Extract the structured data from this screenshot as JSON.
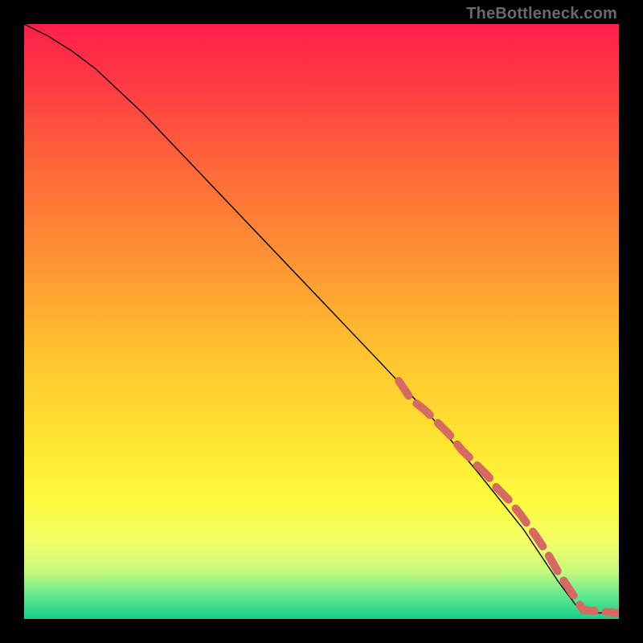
{
  "watermark": "TheBottleneck.com",
  "chart_data": {
    "type": "line",
    "title": "",
    "xlabel": "",
    "ylabel": "",
    "xlim": [
      0,
      100
    ],
    "ylim": [
      0,
      100
    ],
    "grid": false,
    "series": [
      {
        "name": "curve",
        "x": [
          0,
          4,
          8,
          12,
          20,
          30,
          40,
          50,
          60,
          68,
          76,
          84,
          90,
          93,
          96,
          100
        ],
        "y": [
          100,
          98,
          95.5,
          92.5,
          85,
          74.5,
          64,
          53.5,
          43,
          34.5,
          25,
          15,
          6,
          2,
          1,
          1
        ],
        "style": "solid",
        "color": "#000000",
        "width": 1.4
      },
      {
        "name": "dashed-overlay",
        "x": [
          63,
          65,
          67.5,
          68.5,
          70,
          71.5,
          73.5,
          75.5,
          78,
          79.5,
          81.5,
          83.5,
          86,
          88,
          90,
          94,
          97.5,
          100
        ],
        "y": [
          40,
          37,
          35,
          34,
          32.5,
          31,
          28.5,
          26.5,
          24,
          22,
          20,
          17.5,
          14,
          11,
          7.5,
          1.5,
          1.2,
          1
        ],
        "style": "dashed",
        "color": "#d66a63",
        "width": 10
      }
    ],
    "background_gradient": {
      "stops": [
        {
          "t": 0.0,
          "color": "#ff1f4b"
        },
        {
          "t": 0.1,
          "color": "#ff3a44"
        },
        {
          "t": 0.25,
          "color": "#ff6a39"
        },
        {
          "t": 0.4,
          "color": "#ff9433"
        },
        {
          "t": 0.55,
          "color": "#ffc22f"
        },
        {
          "t": 0.7,
          "color": "#ffe42f"
        },
        {
          "t": 0.8,
          "color": "#fdfb3d"
        },
        {
          "t": 0.87,
          "color": "#f3fd66"
        },
        {
          "t": 0.92,
          "color": "#c7f97d"
        },
        {
          "t": 0.96,
          "color": "#63e98f"
        },
        {
          "t": 1.0,
          "color": "#17cf87"
        }
      ]
    }
  }
}
